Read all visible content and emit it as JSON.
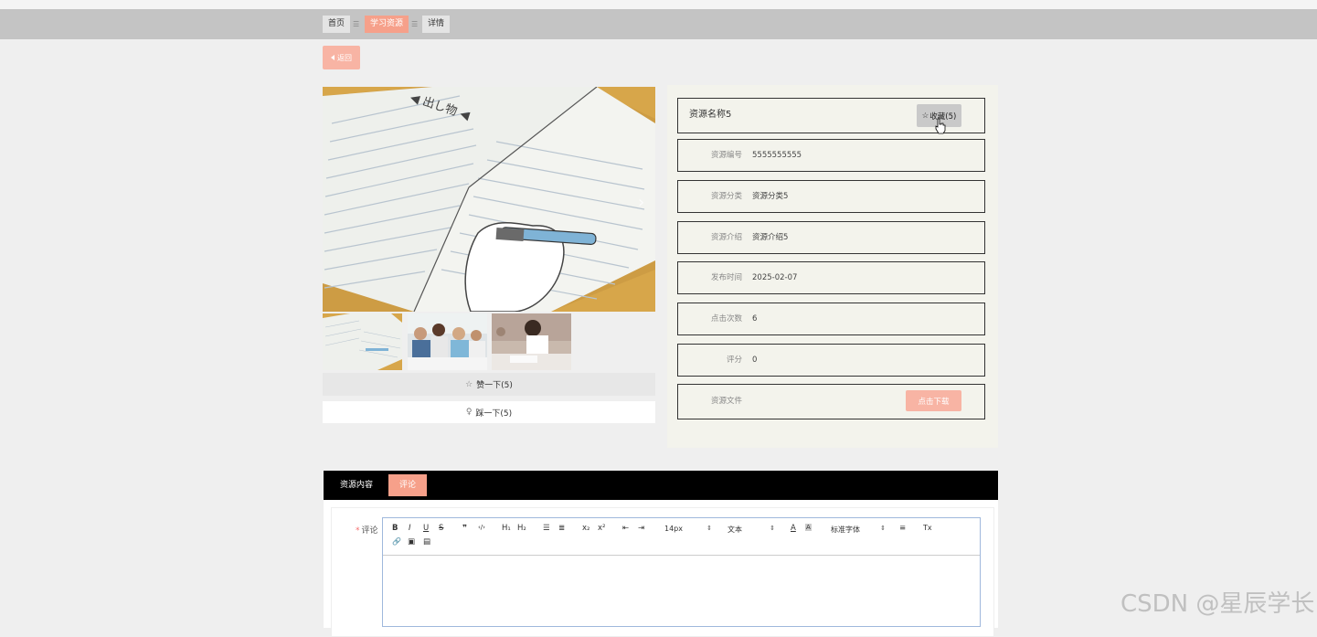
{
  "breadcrumb": {
    "home": "首页",
    "section": "学习资源",
    "current": "详情",
    "separator": "☰"
  },
  "back_button": {
    "label": "返回"
  },
  "gallery": {
    "thumbnails": [
      "notebook-writing",
      "group-people",
      "student-writing"
    ]
  },
  "actions": {
    "like_label": "赞一下(5)",
    "dislike_label": "踩一下(5)"
  },
  "resource": {
    "name": "资源名称5",
    "favorite_label": "收藏(5)",
    "fields": [
      {
        "label": "资源编号",
        "value": "5555555555"
      },
      {
        "label": "资源分类",
        "value": "资源分类5"
      },
      {
        "label": "资源介绍",
        "value": "资源介绍5"
      },
      {
        "label": "发布时间",
        "value": "2025-02-07"
      },
      {
        "label": "点击次数",
        "value": "6"
      },
      {
        "label": "评分",
        "value": "0"
      }
    ],
    "file": {
      "label": "资源文件",
      "download_label": "点击下载"
    }
  },
  "tabs": [
    {
      "label": "资源内容"
    },
    {
      "label": "评论"
    }
  ],
  "comment": {
    "label": "评论",
    "required_mark": "*",
    "toolbar": {
      "bold": "B",
      "italic": "I",
      "underline": "U",
      "strike": "S",
      "quote": "❞",
      "code": "‹/›",
      "h1": "H₁",
      "h2": "H₂",
      "ordered_list": "☰",
      "bullet_list": "≣",
      "sub": "x₂",
      "sup": "x²",
      "outdent": "⇤",
      "indent": "⇥",
      "size": "14px",
      "header": "文本",
      "font": "标准字体",
      "color": "A",
      "background": "A",
      "align": "≡",
      "clean": "Tx",
      "link": "🔗",
      "image": "▣",
      "video": "▤"
    }
  },
  "watermark": "CSDN @星辰学长",
  "colors": {
    "accent": "#f6a08a",
    "crumb_bar": "#c4c4c4",
    "tab_bar": "#000000",
    "panel": "#f3f3ec"
  }
}
